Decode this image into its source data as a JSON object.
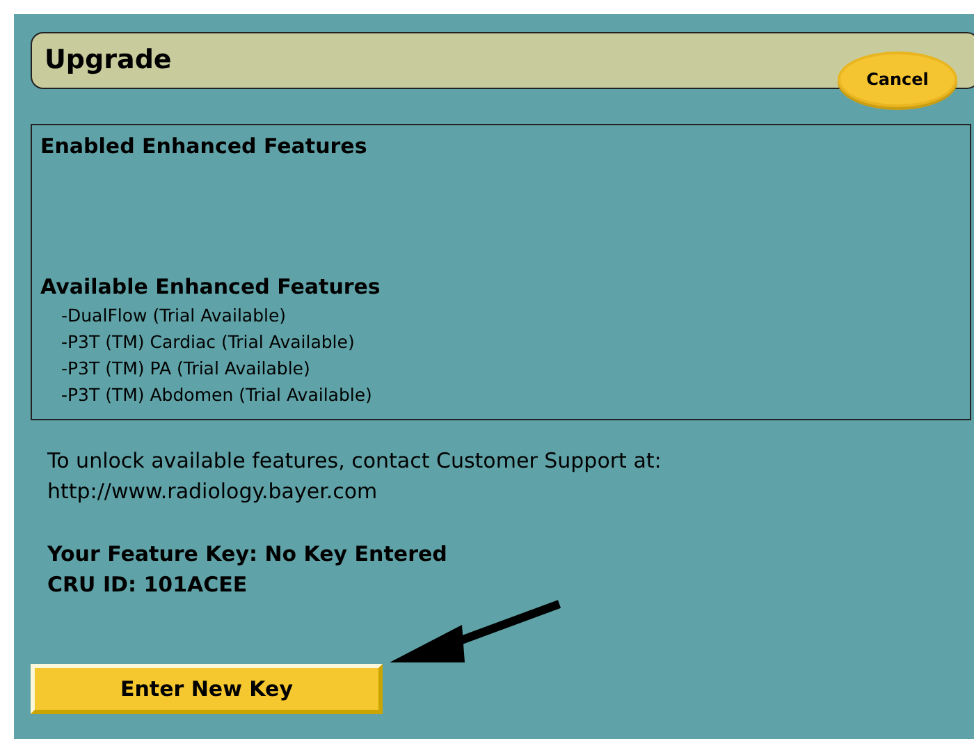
{
  "header": {
    "title": "Upgrade",
    "cancel_button": "Cancel"
  },
  "features_panel": {
    "enabled_heading": "Enabled Enhanced Features",
    "available_heading": "Available Enhanced Features",
    "available_items": [
      "-DualFlow (Trial Available)",
      "-P3T (TM) Cardiac (Trial Available)",
      "-P3T (TM) PA (Trial Available)",
      "-P3T (TM) Abdomen (Trial Available)"
    ]
  },
  "contact_lines": [
    "To unlock available features, contact Customer Support at:",
    "http://www.radiology.bayer.com"
  ],
  "key_lines": [
    "Your Feature Key: No Key Entered",
    "CRU ID: 101ACEE"
  ],
  "enter_key_button": "Enter New Key"
}
